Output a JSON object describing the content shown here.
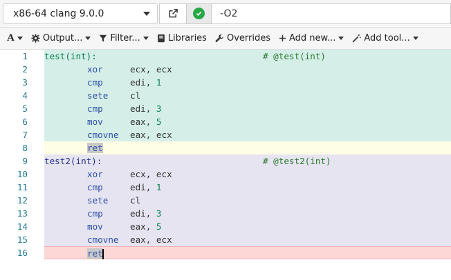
{
  "compiler": {
    "name": "x86-64 clang 9.0.0"
  },
  "options": {
    "value": "-O2"
  },
  "toolbar": {
    "font": "A",
    "output": "Output...",
    "filter": "Filter...",
    "libraries": "Libraries",
    "overrides": "Overrides",
    "add_new": "Add new...",
    "add_tool": "Add tool..."
  },
  "lines": [
    {
      "n": "1",
      "label": "test(int):",
      "comment": "# @test(int)"
    },
    {
      "n": "2",
      "instr": "xor",
      "ops": "ecx, ecx"
    },
    {
      "n": "3",
      "instr": "cmp",
      "ops": "edi, ",
      "num": "1"
    },
    {
      "n": "4",
      "instr": "sete",
      "ops": "cl"
    },
    {
      "n": "5",
      "instr": "cmp",
      "ops": "edi, ",
      "num": "3"
    },
    {
      "n": "6",
      "instr": "mov",
      "ops": "eax, ",
      "num": "5"
    },
    {
      "n": "7",
      "instr": "cmovne",
      "ops": "eax, ecx"
    },
    {
      "n": "8",
      "instr": "ret"
    },
    {
      "n": "9",
      "label": "test2(int):",
      "comment": "# @test2(int)"
    },
    {
      "n": "10",
      "instr": "xor",
      "ops": "ecx, ecx"
    },
    {
      "n": "11",
      "instr": "cmp",
      "ops": "edi, ",
      "num": "1"
    },
    {
      "n": "12",
      "instr": "sete",
      "ops": "cl"
    },
    {
      "n": "13",
      "instr": "cmp",
      "ops": "edi, ",
      "num": "3"
    },
    {
      "n": "14",
      "instr": "mov",
      "ops": "eax, ",
      "num": "5"
    },
    {
      "n": "15",
      "instr": "cmovne",
      "ops": "eax, ecx"
    },
    {
      "n": "16",
      "instr": "ret"
    }
  ]
}
